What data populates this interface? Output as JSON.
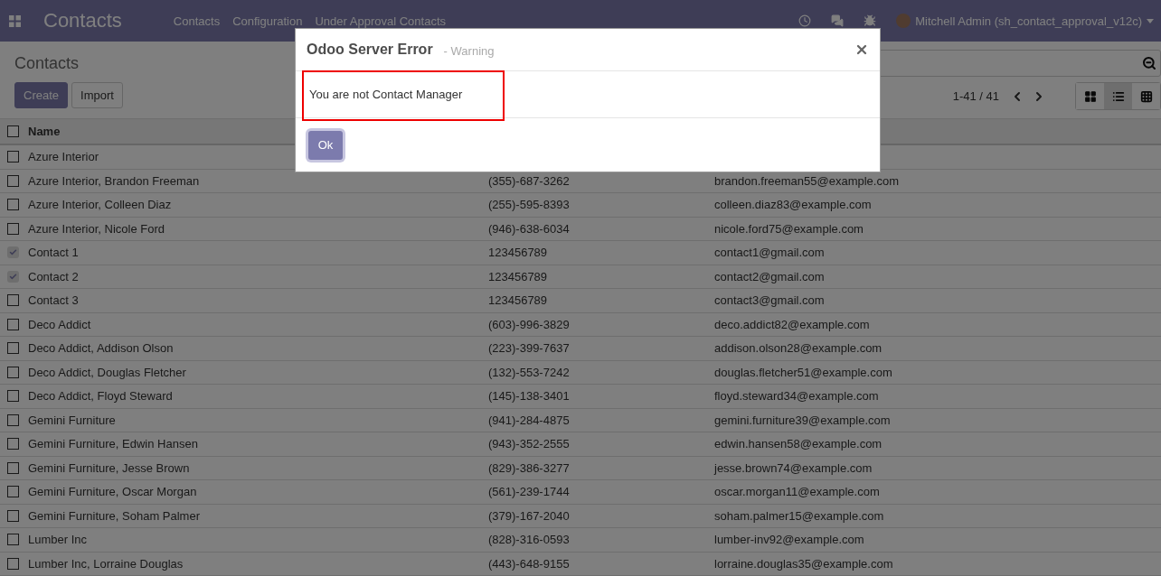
{
  "navbar": {
    "app_title": "Contacts",
    "menu": [
      "Contacts",
      "Configuration",
      "Under Approval Contacts"
    ],
    "user": "Mitchell Admin (sh_contact_approval_v12c)"
  },
  "control_panel": {
    "breadcrumb": "Contacts",
    "buttons": [
      {
        "label": "Create",
        "kind": "primary"
      },
      {
        "label": "Import",
        "kind": "secondary"
      }
    ],
    "pager": "1-41 / 41",
    "views": [
      {
        "kind": "kanban",
        "selected": false
      },
      {
        "kind": "list",
        "selected": true
      },
      {
        "kind": "grid",
        "selected": false
      }
    ]
  },
  "table": {
    "columns": [
      "Name"
    ],
    "all_checked": false,
    "rows": [
      {
        "name": "Azure Interior",
        "checked": false
      },
      {
        "name": "Azure Interior, Brandon Freeman",
        "phone": "(355)-687-3262",
        "email": "brandon.freeman55@example.com",
        "checked": false
      },
      {
        "name": "Azure Interior, Colleen Diaz",
        "phone": "(255)-595-8393",
        "email": "colleen.diaz83@example.com",
        "checked": false
      },
      {
        "name": "Azure Interior, Nicole Ford",
        "phone": "(946)-638-6034",
        "email": "nicole.ford75@example.com",
        "checked": false
      },
      {
        "name": "Contact 1",
        "phone": "123456789",
        "email": "contact1@gmail.com",
        "checked": true
      },
      {
        "name": "Contact 2",
        "phone": "123456789",
        "email": "contact2@gmail.com",
        "checked": true
      },
      {
        "name": "Contact 3",
        "phone": "123456789",
        "email": "contact3@gmail.com",
        "checked": false
      },
      {
        "name": "Deco Addict",
        "phone": "(603)-996-3829",
        "email": "deco.addict82@example.com",
        "checked": false
      },
      {
        "name": "Deco Addict, Addison Olson",
        "phone": "(223)-399-7637",
        "email": "addison.olson28@example.com",
        "checked": false
      },
      {
        "name": "Deco Addict, Douglas Fletcher",
        "phone": "(132)-553-7242",
        "email": "douglas.fletcher51@example.com",
        "checked": false
      },
      {
        "name": "Deco Addict, Floyd Steward",
        "phone": "(145)-138-3401",
        "email": "floyd.steward34@example.com",
        "checked": false
      },
      {
        "name": "Gemini Furniture",
        "phone": "(941)-284-4875",
        "email": "gemini.furniture39@example.com",
        "checked": false
      },
      {
        "name": "Gemini Furniture, Edwin Hansen",
        "phone": "(943)-352-2555",
        "email": "edwin.hansen58@example.com",
        "checked": false
      },
      {
        "name": "Gemini Furniture, Jesse Brown",
        "phone": "(829)-386-3277",
        "email": "jesse.brown74@example.com",
        "checked": false
      },
      {
        "name": "Gemini Furniture, Oscar Morgan",
        "phone": "(561)-239-1744",
        "email": "oscar.morgan11@example.com",
        "checked": false
      },
      {
        "name": "Gemini Furniture, Soham Palmer",
        "phone": "(379)-167-2040",
        "email": "soham.palmer15@example.com",
        "checked": false
      },
      {
        "name": "Lumber Inc",
        "phone": "(828)-316-0593",
        "email": "lumber-inv92@example.com",
        "checked": false
      },
      {
        "name": "Lumber Inc, Lorraine Douglas",
        "phone": "(443)-648-9155",
        "email": "lorraine.douglas35@example.com",
        "checked": false
      }
    ]
  },
  "dialog": {
    "title": "Odoo Server Error",
    "subtitle": "- Warning",
    "message": "You are not Contact Manager",
    "button": "Ok"
  }
}
